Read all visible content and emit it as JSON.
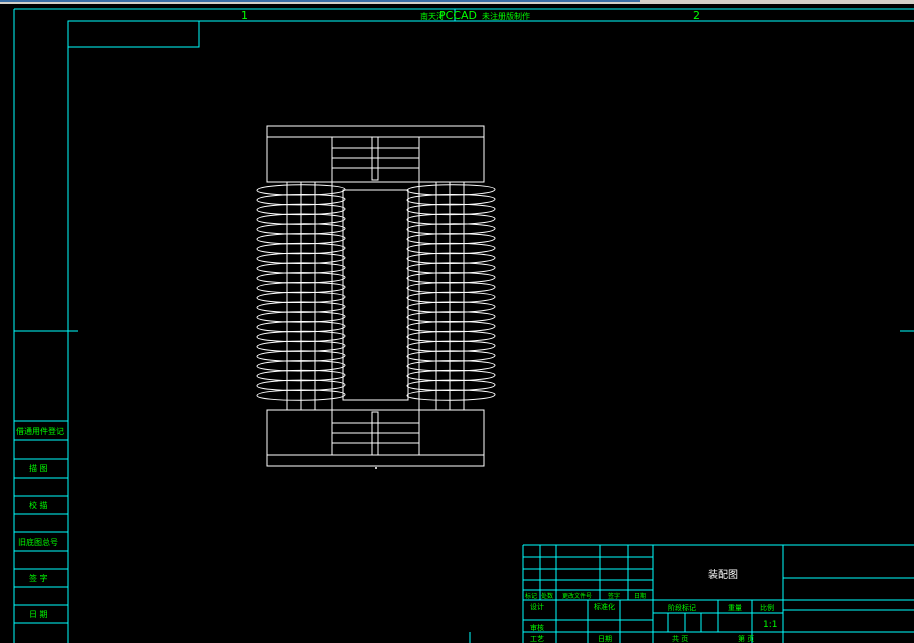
{
  "drawing": {
    "header_left_zone": "1",
    "header_right_zone": "2",
    "header_prefix": "南天河",
    "header_brand": "PCCAD",
    "header_suffix": "未注册版制作",
    "colors": {
      "border": "#00ffff",
      "text": "#00ff00",
      "geometry": "#ffffff",
      "background": "#000000"
    }
  },
  "side_block": {
    "labels": [
      "借通用件登记",
      "描 图",
      "校 描",
      "旧底图总号",
      "签 字",
      "日 期"
    ]
  },
  "title_block": {
    "drawing_name": "装配图",
    "scale": "1:1",
    "row_labels": [
      "标记",
      "处数",
      "更改文件号",
      "签字",
      "日期"
    ],
    "designer_label": "设计",
    "standardization_label": "标准化",
    "stage_mark_label": "阶段标记",
    "weight_label": "重量",
    "ratio_label": "比例",
    "review_label": "审核",
    "process_label": "工艺",
    "approve_label": "日期",
    "sheet_total_label": "共 页",
    "sheet_label": "第 页"
  }
}
